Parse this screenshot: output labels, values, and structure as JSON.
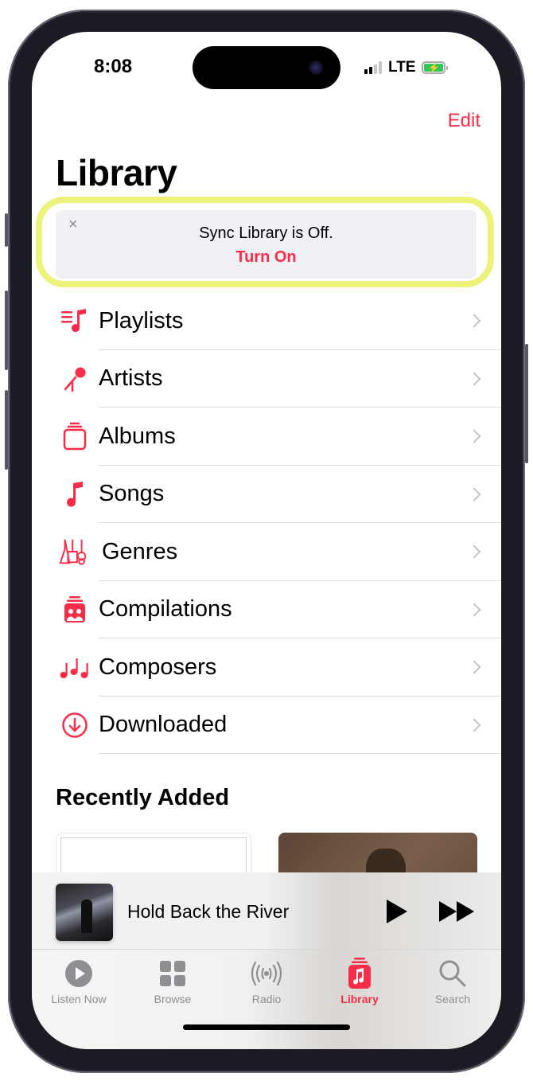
{
  "status_bar": {
    "time": "8:08",
    "network": "LTE",
    "signal_bars_filled": 2,
    "signal_bars_total": 4,
    "battery_state": "charging"
  },
  "header": {
    "edit_label": "Edit",
    "title": "Library"
  },
  "sync_banner": {
    "close_icon": "×",
    "message": "Sync Library is Off.",
    "action_label": "Turn On",
    "highlight_color": "#ecf27a"
  },
  "library_items": [
    {
      "label": "Playlists",
      "icon": "playlist-icon"
    },
    {
      "label": "Artists",
      "icon": "microphone-icon"
    },
    {
      "label": "Albums",
      "icon": "album-stack-icon"
    },
    {
      "label": "Songs",
      "icon": "music-note-icon"
    },
    {
      "label": "Genres",
      "icon": "guitars-icon"
    },
    {
      "label": "Compilations",
      "icon": "compilation-icon"
    },
    {
      "label": "Composers",
      "icon": "music-notes-icon"
    },
    {
      "label": "Downloaded",
      "icon": "download-circle-icon"
    }
  ],
  "recently_added": {
    "title": "Recently Added"
  },
  "mini_player": {
    "song_title": "Hold Back the River"
  },
  "tabs": [
    {
      "label": "Listen Now",
      "icon": "play-circle-icon",
      "active": false
    },
    {
      "label": "Browse",
      "icon": "grid-icon",
      "active": false
    },
    {
      "label": "Radio",
      "icon": "radio-waves-icon",
      "active": false
    },
    {
      "label": "Library",
      "icon": "library-icon",
      "active": true
    },
    {
      "label": "Search",
      "icon": "search-icon",
      "active": false
    }
  ],
  "colors": {
    "accent": "#fa2d48",
    "inactive": "#8e8e93",
    "chevron": "#c4c4c7"
  }
}
